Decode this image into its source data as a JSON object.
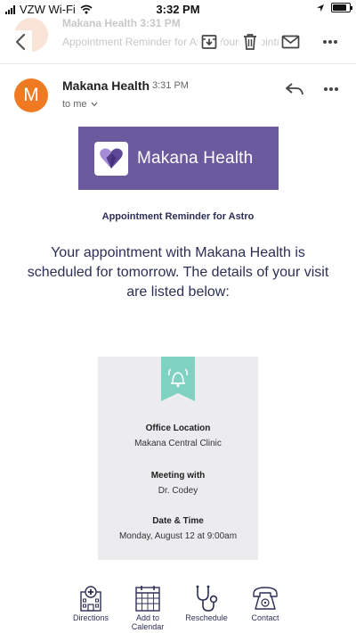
{
  "status_bar": {
    "carrier": "VZW Wi-Fi",
    "time": "3:32 PM",
    "battery_level": 0.85
  },
  "toolbar": {
    "behind_sender": "Makana Health",
    "behind_time": "3:31 PM",
    "behind_snippet": "Appointment Reminder for Astro  Your appointment",
    "icons": [
      "back-arrow-icon",
      "archive-icon",
      "trash-icon",
      "mail-icon",
      "more-icon"
    ]
  },
  "message": {
    "avatar_letter": "M",
    "avatar_color": "#f07a22",
    "sender": "Makana Health",
    "time": "3:31 PM",
    "recipient": "to me"
  },
  "email": {
    "brand_name": "Makana Health",
    "brand_color": "#6c5a9f",
    "subject": "Appointment Reminder for Astro",
    "intro": "Your appointment with Makana Health is scheduled for tomorrow. The details of your visit are listed below:",
    "accent_color": "#7fd1c1",
    "details": [
      {
        "label": "Office Location",
        "value": "Makana Central Clinic"
      },
      {
        "label": "Meeting with",
        "value": "Dr. Codey"
      },
      {
        "label": "Date & Time",
        "value": "Monday, August 12 at 9:00am"
      }
    ],
    "actions": [
      {
        "label": "Directions",
        "icon": "hospital-icon"
      },
      {
        "label": "Add to Calendar",
        "icon": "calendar-icon"
      },
      {
        "label": "Reschedule",
        "icon": "stethoscope-icon"
      },
      {
        "label": "Contact",
        "icon": "telephone-icon"
      }
    ]
  }
}
